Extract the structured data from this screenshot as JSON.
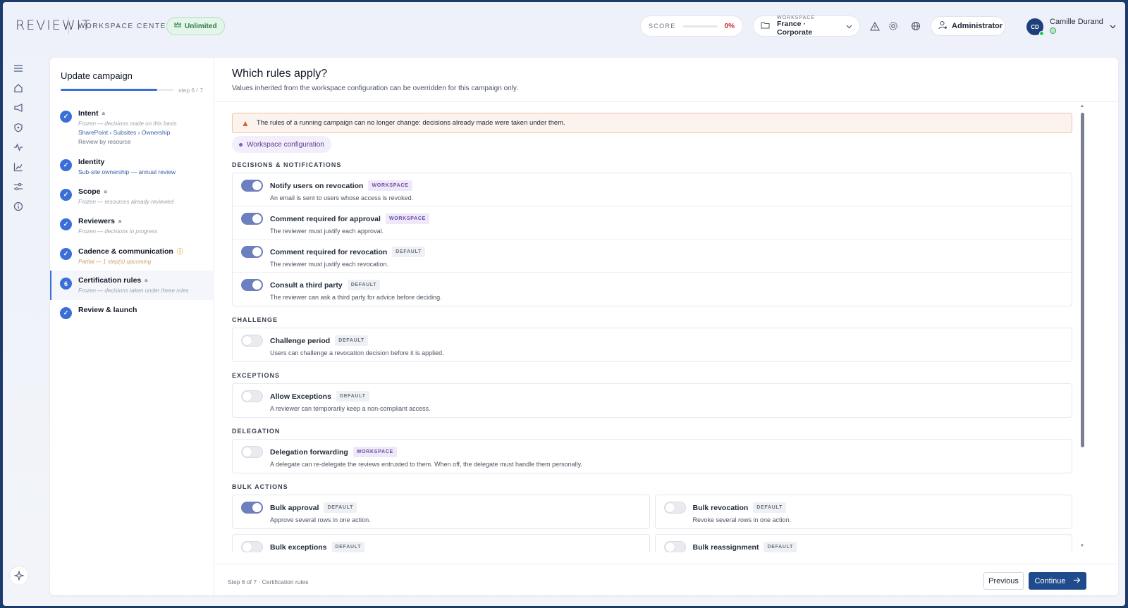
{
  "header": {
    "logo": "REVIEWIT",
    "section": "WORKSPACE CENTER",
    "plan_badge": "Unlimited",
    "score_label": "SCORE",
    "score_value": "0%",
    "score_fraction": 0,
    "workspace_small": "WORKSPACE",
    "workspace_name": "France · Corporate",
    "role": "Administrator",
    "user_initials": "CD",
    "user_name": "Camille Durand"
  },
  "steps": {
    "title": "Update campaign",
    "count": "step 6 / 7",
    "progress_fraction": 0.857,
    "items": [
      {
        "name": "Intent",
        "sub": "Frozen — decisions made on this basis",
        "link": "SharePoint › Subsites › Ownership",
        "meta": "Review by resource"
      },
      {
        "name": "Identity",
        "link": "Sub-site ownership — annual review"
      },
      {
        "name": "Scope",
        "sub": "Frozen — resources already reviewed"
      },
      {
        "name": "Reviewers",
        "sub": "Frozen — decisions in progress"
      },
      {
        "name": "Cadence & communication",
        "sub": "Partial — 1 step(s) upcoming"
      },
      {
        "name": "Certification rules",
        "number": "6",
        "sub": "Frozen — decisions taken under these rules"
      },
      {
        "name": "Review & launch"
      }
    ]
  },
  "main": {
    "title": "Which rules apply?",
    "subtitle": "Values inherited from the workspace configuration can be overridden for this campaign only.",
    "alert": "The rules of a running campaign can no longer change: decisions already made were taken under them.",
    "chip": "Workspace configuration",
    "sections": {
      "decisions": "DECISIONS & NOTIFICATIONS",
      "challenge": "CHALLENGE",
      "exceptions": "EXCEPTIONS",
      "delegation": "DELEGATION",
      "bulk": "BULK ACTIONS"
    },
    "rules": {
      "notify": {
        "title": "Notify users on revocation",
        "tag": "WORKSPACE",
        "desc": "An email is sent to users whose access is revoked.",
        "on": true
      },
      "comment_approval": {
        "title": "Comment required for approval",
        "tag": "WORKSPACE",
        "desc": "The reviewer must justify each approval.",
        "on": true
      },
      "comment_revocation": {
        "title": "Comment required for revocation",
        "tag": "DEFAULT",
        "desc": "The reviewer must justify each revocation.",
        "on": true
      },
      "third_party": {
        "title": "Consult a third party",
        "tag": "DEFAULT",
        "desc": "The reviewer can ask a third party for advice before deciding.",
        "on": true
      },
      "challenge_period": {
        "title": "Challenge period",
        "tag": "DEFAULT",
        "desc": "Users can challenge a revocation decision before it is applied.",
        "on": false
      },
      "allow_exceptions": {
        "title": "Allow Exceptions",
        "tag": "DEFAULT",
        "desc": "A reviewer can temporarily keep a non-compliant access.",
        "on": false
      },
      "delegation_forwarding": {
        "title": "Delegation forwarding",
        "tag": "WORKSPACE",
        "desc": "A delegate can re-delegate the reviews entrusted to them. When off, the delegate must handle them personally.",
        "on": false
      },
      "bulk_approval": {
        "title": "Bulk approval",
        "tag": "DEFAULT",
        "desc": "Approve several rows in one action.",
        "on": true
      },
      "bulk_revocation": {
        "title": "Bulk revocation",
        "tag": "DEFAULT",
        "desc": "Revoke several rows in one action.",
        "on": false
      },
      "bulk_exceptions": {
        "title": "Bulk exceptions",
        "tag": "DEFAULT",
        "desc": "",
        "on": false
      },
      "bulk_reassignment": {
        "title": "Bulk reassignment",
        "tag": "DEFAULT",
        "desc": "",
        "on": false
      }
    }
  },
  "footer": {
    "status": "Step 6 of 7 · Certification rules",
    "previous": "Previous",
    "continue": "Continue"
  },
  "colors": {
    "accent": "#3a6fd8",
    "primary_button": "#1f4a8c",
    "toggle_on": "#6c7fbe",
    "alert_bg": "#fdf3ee",
    "score_red": "#c2272d"
  }
}
